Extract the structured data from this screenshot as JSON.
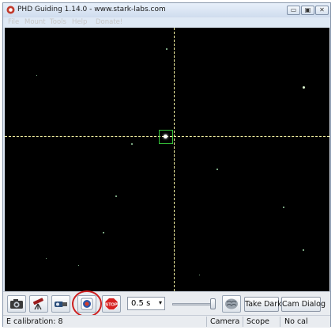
{
  "window": {
    "title": "PHD Guiding 1.14.0  -  www.stark-labs.com",
    "controls": {
      "minimize": "▭",
      "maximize": "▣",
      "close": "✕"
    }
  },
  "menu": {
    "items": [
      {
        "label": "File"
      },
      {
        "label": "Mount"
      },
      {
        "label": "Tools"
      },
      {
        "label": "Help"
      },
      {
        "label": "Donate!"
      }
    ]
  },
  "toolbar": {
    "icons": [
      "camera-icon",
      "telescope-icon",
      "gear-cable-icon",
      "phd-guide-icon",
      "stop-icon",
      "brain-icon"
    ],
    "exposure": {
      "value": "0.5 s",
      "arrow": "▾"
    },
    "stop_label": "STOP",
    "take_dark_label": "Take Dark",
    "cam_dialog_label": "Cam Dialog",
    "highlight_color": "#cc1f1f"
  },
  "status": {
    "message": "E calibration: 8",
    "camera": "Camera",
    "scope": "Scope",
    "calibration": "No cal"
  },
  "colors": {
    "viewport_bg": "#000000",
    "crosshair": "#f3f0a0",
    "guide_box": "#35c23a"
  }
}
